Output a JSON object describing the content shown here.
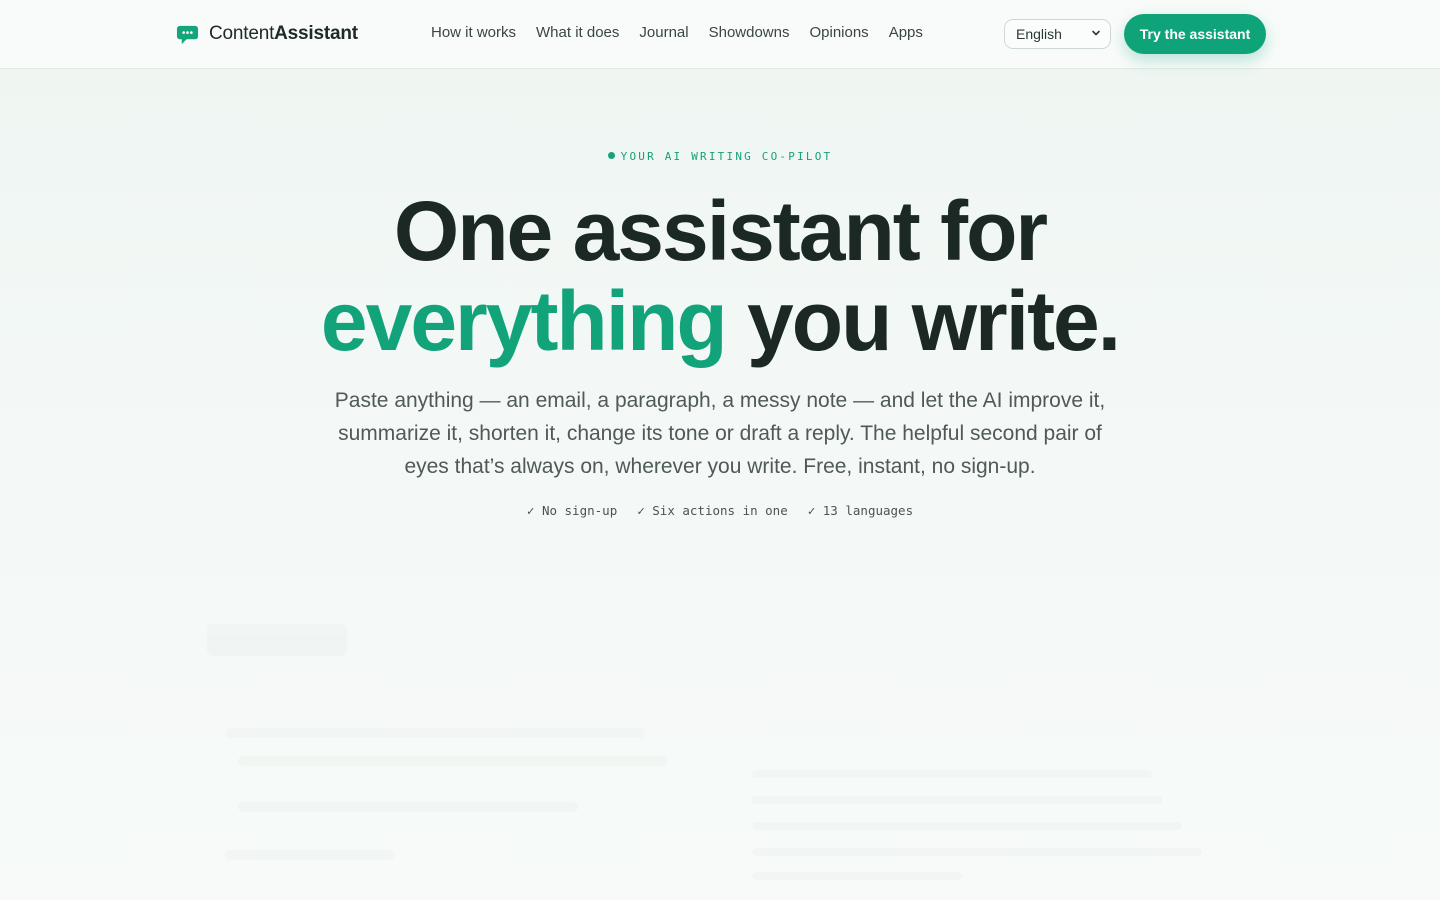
{
  "brand": {
    "name_light": "Content",
    "name_bold": "Assistant"
  },
  "nav": [
    "How it works",
    "What it does",
    "Journal",
    "Showdowns",
    "Opinions",
    "Apps"
  ],
  "language": {
    "selected": "English"
  },
  "cta_label": "Try the assistant",
  "hero": {
    "eyebrow": "YOUR AI WRITING CO-PILOT",
    "headline_line1": "One assistant for",
    "headline_accent": "everything",
    "headline_rest": " you write.",
    "subtitle": "Paste anything — an email, a paragraph, a messy note — and let the AI improve it, summarize it, shorten it, change its tone or draft a reply. The helpful second pair of eyes that’s always on, wherever you write. Free, instant, no sign-up.",
    "checks": [
      "✓ No sign-up",
      "✓ Six actions in one",
      "✓ 13 languages"
    ]
  },
  "colors": {
    "accent": "#12a37b",
    "text": "#1b2823",
    "muted": "#4f5a55"
  }
}
